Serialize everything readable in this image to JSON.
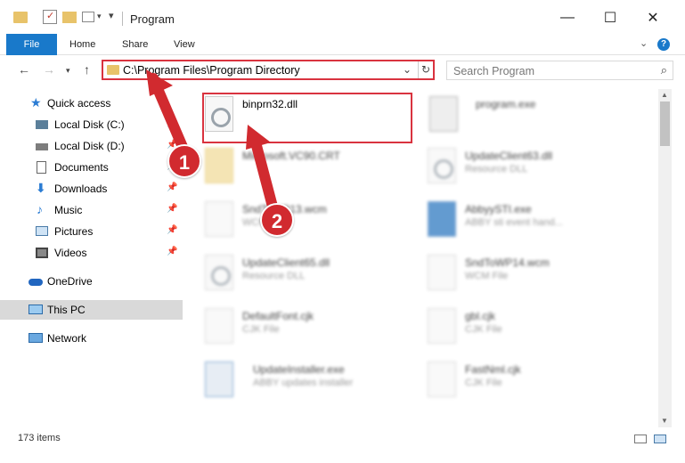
{
  "window": {
    "title": "Program",
    "minimize": "—",
    "maximize": "☐",
    "close": "✕"
  },
  "ribbon": {
    "tabs": [
      "File",
      "Home",
      "Share",
      "View"
    ],
    "help": "?"
  },
  "address": {
    "path": "C:\\Program Files\\Program Directory",
    "search_placeholder": "Search Program"
  },
  "sidebar": {
    "items": [
      {
        "label": "Quick access",
        "icon": "star-icon"
      },
      {
        "label": "Local Disk (C:)",
        "icon": "drive-icon"
      },
      {
        "label": "Local Disk (D:)",
        "icon": "drive-icon"
      },
      {
        "label": "Documents",
        "icon": "documents-icon"
      },
      {
        "label": "Downloads",
        "icon": "download-icon"
      },
      {
        "label": "Music",
        "icon": "music-icon"
      },
      {
        "label": "Pictures",
        "icon": "pictures-icon"
      },
      {
        "label": "Videos",
        "icon": "videos-icon"
      },
      {
        "label": "OneDrive",
        "icon": "cloud-icon"
      },
      {
        "label": "This PC",
        "icon": "pc-icon"
      },
      {
        "label": "Network",
        "icon": "network-icon"
      }
    ]
  },
  "files": [
    {
      "name": "binprn32.dll",
      "sub": ""
    },
    {
      "name": "program.exe",
      "sub": ""
    },
    {
      "name": "Microsoft.VC90.CRT",
      "sub": ""
    },
    {
      "name": "UpdateClient63.dll",
      "sub": "Resource DLL"
    },
    {
      "name": "SndToWP13.wcm",
      "sub": "WCM File"
    },
    {
      "name": "AbbyySTI.exe",
      "sub": "ABBY sti event hand..."
    },
    {
      "name": "UpdateClient65.dll",
      "sub": "Resource DLL"
    },
    {
      "name": "SndToWP14.wcm",
      "sub": "WCM File"
    },
    {
      "name": "DefaultFont.cjk",
      "sub": "CJK File"
    },
    {
      "name": "gbl.cjk",
      "sub": "CJK File"
    },
    {
      "name": "UpdateInstaller.exe",
      "sub": "ABBY updates installer"
    },
    {
      "name": "FastNml.cjk",
      "sub": "CJK File"
    }
  ],
  "status": {
    "count": "173 items"
  },
  "annotations": {
    "badge1": "1",
    "badge2": "2"
  },
  "colors": {
    "accent": "#1979ca",
    "highlight": "#d9333f",
    "badge": "#d12a2f"
  }
}
